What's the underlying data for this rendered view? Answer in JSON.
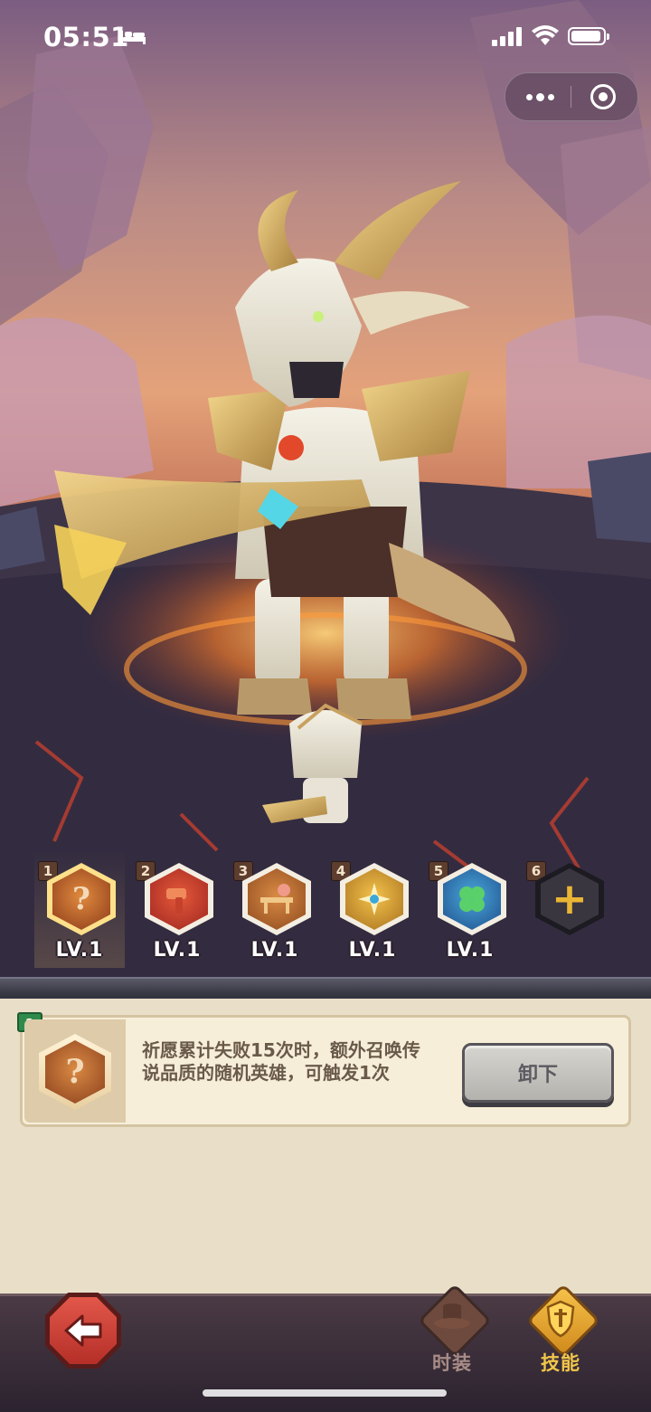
{
  "status_bar": {
    "time": "05:51"
  },
  "capsule": {
    "more_icon": "more-dots-icon",
    "close_icon": "target-circle-icon"
  },
  "skill_slots": [
    {
      "number": "1",
      "level": "LV.1",
      "icon": "question-mark-icon",
      "color": "#c86a2c",
      "selected": true
    },
    {
      "number": "2",
      "level": "LV.1",
      "icon": "hammer-fist-icon",
      "color": "#c8322a",
      "selected": false
    },
    {
      "number": "3",
      "level": "LV.1",
      "icon": "bench-bear-icon",
      "color": "#c07834",
      "selected": false
    },
    {
      "number": "4",
      "level": "LV.1",
      "icon": "compass-star-icon",
      "color": "#d2a032",
      "selected": false
    },
    {
      "number": "5",
      "level": "LV.1",
      "icon": "clover-icon",
      "color": "#2f7fb8",
      "selected": false
    },
    {
      "number": "6",
      "level": "",
      "icon": "plus-icon",
      "color": "#3a3640",
      "selected": false
    }
  ],
  "detail": {
    "badge": "1",
    "icon": "question-mark-icon",
    "description": "祈愿累计失败15次时，额外召唤传说品质的随机英雄，可触发1次",
    "unequip_label": "卸下"
  },
  "bottom_nav": {
    "back_icon": "back-arrow-icon",
    "tabs": [
      {
        "label": "时装",
        "icon": "hat-icon",
        "active": false
      },
      {
        "label": "技能",
        "icon": "shield-sword-icon",
        "active": true
      }
    ]
  },
  "colors": {
    "panel_bg": "#e9dfc9",
    "card_bg": "#f7eed9",
    "accent_gold": "#e9b534",
    "back_red": "#d2443a",
    "badge_green": "#2f8a4b"
  }
}
